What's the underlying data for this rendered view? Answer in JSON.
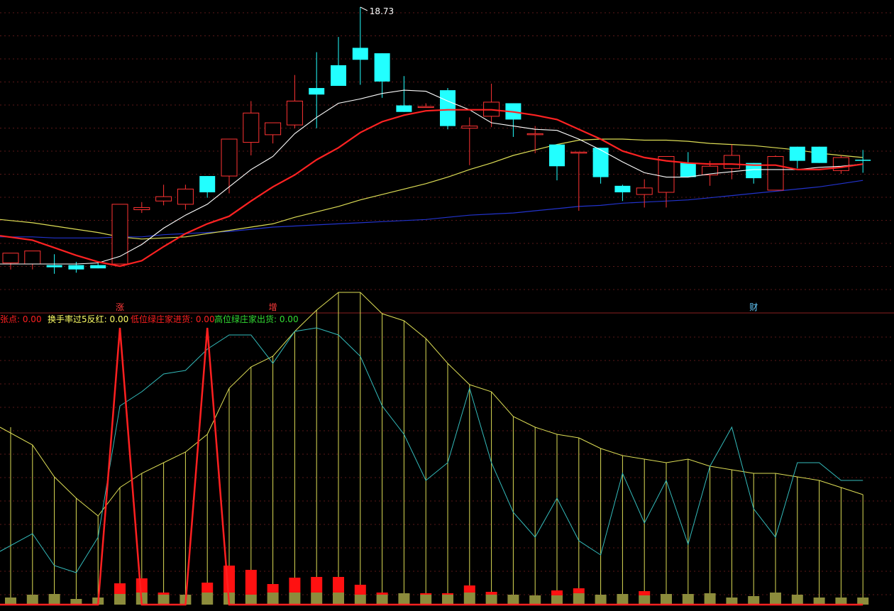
{
  "chart_data": [
    {
      "type": "candlestick",
      "panel": "price",
      "max_label": "18.73",
      "candles": [
        {
          "o": 14.02,
          "h": 14.12,
          "l": 13.9,
          "c": 14.2
        },
        {
          "o": 14.0,
          "h": 14.06,
          "l": 13.9,
          "c": 14.24
        },
        {
          "o": 13.98,
          "h": 14.18,
          "l": 13.82,
          "c": 13.94
        },
        {
          "o": 13.98,
          "h": 14.04,
          "l": 13.84,
          "c": 13.9
        },
        {
          "o": 13.98,
          "h": 14.04,
          "l": 13.92,
          "c": 13.92
        },
        {
          "o": 14.0,
          "h": 15.1,
          "l": 14.0,
          "c": 15.1
        },
        {
          "o": 15.0,
          "h": 15.14,
          "l": 14.94,
          "c": 15.04
        },
        {
          "o": 15.16,
          "h": 15.46,
          "l": 15.08,
          "c": 15.24
        },
        {
          "o": 15.1,
          "h": 15.46,
          "l": 15.0,
          "c": 15.38
        },
        {
          "o": 15.62,
          "h": 15.62,
          "l": 15.22,
          "c": 15.32
        },
        {
          "o": 15.62,
          "h": 16.28,
          "l": 15.3,
          "c": 16.3
        },
        {
          "o": 16.24,
          "h": 17.0,
          "l": 16.0,
          "c": 16.78
        },
        {
          "o": 16.38,
          "h": 16.6,
          "l": 16.22,
          "c": 16.6
        },
        {
          "o": 16.56,
          "h": 17.48,
          "l": 16.5,
          "c": 17.0
        },
        {
          "o": 17.24,
          "h": 17.9,
          "l": 16.5,
          "c": 17.12
        },
        {
          "o": 17.66,
          "h": 18.18,
          "l": 17.3,
          "c": 17.28
        },
        {
          "o": 17.98,
          "h": 18.73,
          "l": 17.3,
          "c": 17.76
        },
        {
          "o": 17.88,
          "h": 17.88,
          "l": 17.06,
          "c": 17.36
        },
        {
          "o": 16.92,
          "h": 17.46,
          "l": 16.8,
          "c": 16.8
        },
        {
          "o": 16.9,
          "h": 16.96,
          "l": 16.88,
          "c": 16.9
        },
        {
          "o": 17.2,
          "h": 17.24,
          "l": 16.48,
          "c": 16.54
        },
        {
          "o": 16.5,
          "h": 16.7,
          "l": 15.82,
          "c": 16.54
        },
        {
          "o": 16.72,
          "h": 17.32,
          "l": 16.52,
          "c": 16.98
        },
        {
          "o": 16.96,
          "h": 16.96,
          "l": 16.34,
          "c": 16.66
        },
        {
          "o": 16.4,
          "h": 16.54,
          "l": 16.04,
          "c": 16.4
        },
        {
          "o": 16.2,
          "h": 16.2,
          "l": 15.54,
          "c": 15.8
        },
        {
          "o": 16.06,
          "h": 16.06,
          "l": 14.98,
          "c": 16.06
        },
        {
          "o": 16.14,
          "h": 16.14,
          "l": 15.48,
          "c": 15.6
        },
        {
          "o": 15.44,
          "h": 15.46,
          "l": 15.16,
          "c": 15.32
        },
        {
          "o": 15.28,
          "h": 15.56,
          "l": 15.04,
          "c": 15.4
        },
        {
          "o": 15.32,
          "h": 15.98,
          "l": 15.04,
          "c": 15.98
        },
        {
          "o": 15.86,
          "h": 16.06,
          "l": 15.6,
          "c": 15.6
        },
        {
          "o": 15.64,
          "h": 15.9,
          "l": 15.44,
          "c": 15.8
        },
        {
          "o": 15.76,
          "h": 16.2,
          "l": 15.56,
          "c": 16.0
        },
        {
          "o": 15.86,
          "h": 15.86,
          "l": 15.48,
          "c": 15.58
        },
        {
          "o": 15.36,
          "h": 16.0,
          "l": 15.36,
          "c": 15.98
        },
        {
          "o": 16.16,
          "h": 16.16,
          "l": 15.76,
          "c": 15.9
        },
        {
          "o": 16.16,
          "h": 16.16,
          "l": 15.86,
          "c": 15.86
        },
        {
          "o": 15.72,
          "h": 16.0,
          "l": 15.66,
          "c": 15.96
        },
        {
          "o": 15.92,
          "h": 16.1,
          "l": 15.68,
          "c": 15.9
        }
      ],
      "ma_white": [
        14.0,
        14.0,
        14.0,
        14.0,
        14.02,
        14.14,
        14.36,
        14.66,
        14.9,
        15.1,
        15.42,
        15.74,
        15.98,
        16.4,
        16.7,
        16.96,
        17.04,
        17.14,
        17.2,
        17.18,
        17.0,
        16.84,
        16.6,
        16.54,
        16.48,
        16.46,
        16.3,
        16.1,
        15.88,
        15.68,
        15.6,
        15.6,
        15.66,
        15.7,
        15.74,
        15.74,
        15.74,
        15.78,
        15.8,
        15.84
      ],
      "ma_red": [
        14.52,
        14.44,
        14.3,
        14.16,
        14.04,
        13.96,
        14.06,
        14.32,
        14.56,
        14.74,
        14.88,
        15.16,
        15.42,
        15.64,
        15.92,
        16.14,
        16.42,
        16.62,
        16.74,
        16.82,
        16.84,
        16.84,
        16.84,
        16.8,
        16.74,
        16.66,
        16.48,
        16.3,
        16.08,
        15.96,
        15.9,
        15.86,
        15.84,
        15.84,
        15.82,
        15.82,
        15.74,
        15.74,
        15.78,
        15.84
      ],
      "ma_yellow": [
        14.82,
        14.76,
        14.7,
        14.64,
        14.58,
        14.5,
        14.46,
        14.48,
        14.5,
        14.56,
        14.62,
        14.68,
        14.74,
        14.86,
        14.96,
        15.06,
        15.18,
        15.28,
        15.38,
        15.48,
        15.6,
        15.74,
        15.86,
        16.0,
        16.1,
        16.2,
        16.28,
        16.3,
        16.3,
        16.28,
        16.28,
        16.26,
        16.22,
        16.2,
        16.18,
        16.14,
        16.1,
        16.04,
        16.0,
        15.96
      ],
      "ma_blue": [
        14.5,
        14.5,
        14.48,
        14.48,
        14.48,
        14.5,
        14.5,
        14.54,
        14.56,
        14.58,
        14.6,
        14.64,
        14.68,
        14.7,
        14.72,
        14.74,
        14.76,
        14.78,
        14.8,
        14.82,
        14.86,
        14.9,
        14.92,
        14.94,
        14.98,
        15.02,
        15.06,
        15.08,
        15.12,
        15.14,
        15.16,
        15.18,
        15.22,
        15.26,
        15.3,
        15.34,
        15.38,
        15.42,
        15.48,
        15.54
      ],
      "markers": [
        {
          "index": 5,
          "text": "涨",
          "color": "#ff3b3b"
        },
        {
          "index": 12,
          "text": "增",
          "color": "#ff3b3b"
        },
        {
          "index": 34,
          "text": "财",
          "color": "#66ccff"
        }
      ]
    },
    {
      "type": "indicator",
      "panel": "volume",
      "legend": [
        {
          "text": "张点: 0.00",
          "color": "#ff2020"
        },
        {
          "text": "换手率过5反红: 0.00",
          "color": "#ffff66"
        },
        {
          "text": "低位绿庄家进货: 0.00",
          "color": "#ff2020"
        },
        {
          "text": "高位绿庄家出货: 0.00",
          "color": "#33dd33"
        }
      ],
      "yellow_line": [
        250,
        225,
        180,
        150,
        125,
        165,
        185,
        200,
        215,
        240,
        305,
        335,
        350,
        385,
        415,
        440,
        440,
        410,
        400,
        375,
        340,
        310,
        300,
        265,
        250,
        240,
        235,
        220,
        210,
        205,
        200,
        205,
        195,
        190,
        185,
        185,
        180,
        175,
        165,
        155
      ],
      "cyan_line": [
        75,
        100,
        55,
        45,
        95,
        280,
        300,
        325,
        330,
        360,
        380,
        380,
        340,
        385,
        390,
        380,
        350,
        280,
        240,
        175,
        200,
        305,
        200,
        130,
        95,
        150,
        90,
        70,
        185,
        115,
        175,
        85,
        195,
        250,
        135,
        95,
        200,
        200,
        175,
        175
      ],
      "red_spike": [
        0,
        0,
        0,
        0,
        0,
        1,
        0,
        0,
        0,
        1,
        0,
        0,
        0,
        0,
        0,
        0,
        0,
        0,
        0,
        0,
        0,
        0,
        0,
        0,
        0,
        0,
        0,
        0,
        0,
        0,
        0,
        0,
        0,
        0,
        0,
        0,
        0,
        0,
        0,
        0
      ],
      "olive_bars": [
        10,
        14,
        15,
        8,
        10,
        15,
        17,
        14,
        14,
        17,
        17,
        14,
        17,
        17,
        17,
        17,
        14,
        14,
        16,
        14,
        14,
        17,
        14,
        14,
        13,
        13,
        16,
        14,
        15,
        13,
        15,
        15,
        16,
        10,
        12,
        17,
        14,
        10,
        10,
        10
      ],
      "red_bars": [
        0,
        0,
        0,
        0,
        0,
        15,
        20,
        3,
        0,
        14,
        38,
        35,
        12,
        21,
        22,
        22,
        14,
        3,
        0,
        2,
        2,
        10,
        4,
        0,
        0,
        7,
        7,
        0,
        0,
        6,
        0,
        0,
        0,
        0,
        0,
        0,
        0,
        0,
        0,
        0
      ]
    }
  ]
}
